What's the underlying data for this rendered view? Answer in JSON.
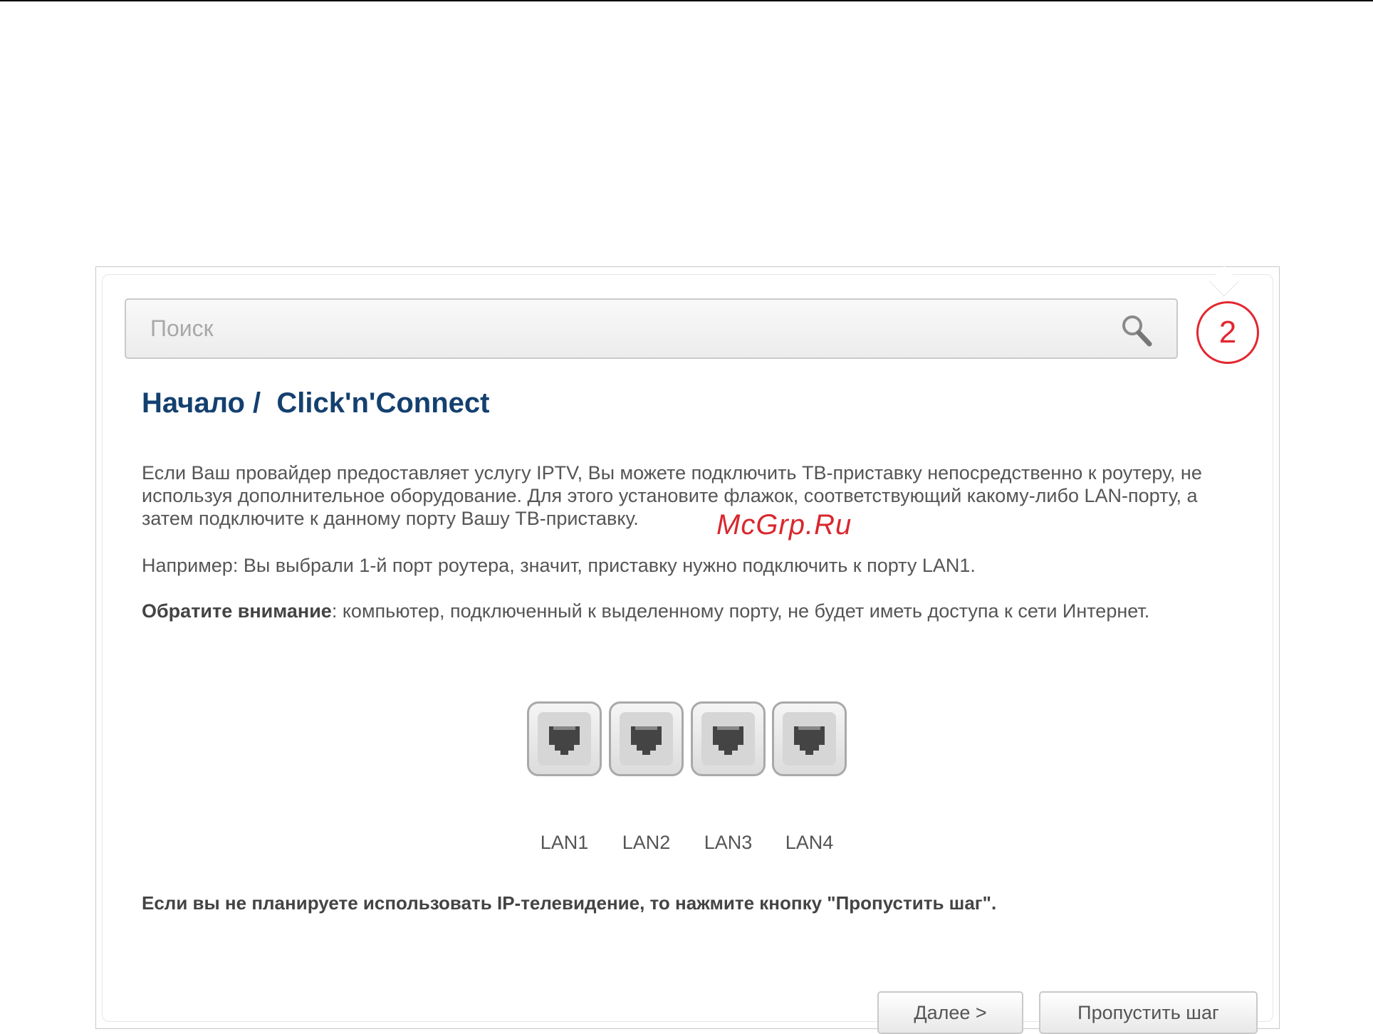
{
  "search": {
    "placeholder": "Поиск",
    "icon": "search-icon"
  },
  "step": {
    "number": "2",
    "color": "#e3262f"
  },
  "header": {
    "title": "Начало /  Click'n'Connect"
  },
  "body": {
    "paragraph1": "Если Ваш провайдер предоставляет услугу IPTV, Вы можете подключить ТВ-приставку непосредственно к роутеру, не используя дополнительное оборудование. Для этого установите флажок, соответствующий какому-либо LAN-порту, а затем подключите к данному порту Вашу ТВ-приставку.",
    "paragraph2": "Например: Вы выбрали 1-й порт роутера, значит, приставку нужно подключить к порту LAN1.",
    "note_label": "Обратите внимание",
    "note_text": ": компьютер, подключенный к выделенному порту, не будет иметь доступа к сети Интернет."
  },
  "ports": [
    {
      "label": "LAN1"
    },
    {
      "label": "LAN2"
    },
    {
      "label": "LAN3"
    },
    {
      "label": "LAN4"
    }
  ],
  "skip_note": "Если вы не планируете использовать IP-телевидение, то нажмите кнопку \"Пропустить шаг\".",
  "buttons": {
    "next": "Далее >",
    "skip": "Пропустить шаг"
  },
  "watermark": "McGrp.Ru",
  "colors": {
    "title": "#14406f",
    "accent": "#e3262f",
    "text": "#555555"
  }
}
